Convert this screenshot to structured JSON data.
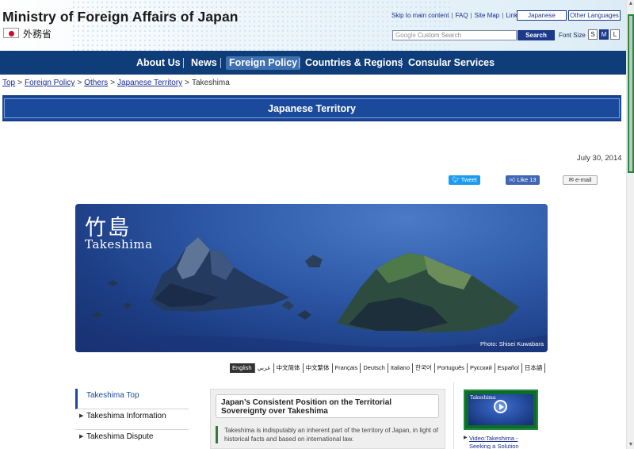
{
  "header": {
    "site_title": "Ministry of Foreign Affairs of Japan",
    "jp_label": "外務省",
    "links": [
      "Skip to main content",
      "FAQ",
      "Site Map",
      "Links"
    ],
    "lang_japanese": "Japanese",
    "lang_other": "Other Languages",
    "search_placeholder": "Custom Search",
    "search_google": "Google",
    "search_button": "Search",
    "font_size_label": "Font Size",
    "font_sizes": [
      "S",
      "M",
      "L"
    ],
    "font_size_selected": "M"
  },
  "nav": {
    "items": [
      "About Us",
      "News",
      "Foreign Policy",
      "Countries & Regions",
      "Consular Services"
    ],
    "active": "Foreign Policy"
  },
  "breadcrumb": {
    "items": [
      "Top",
      "Foreign Policy",
      "Others",
      "Japanese Territory"
    ],
    "current": "Takeshima"
  },
  "banner_title": "Japanese Territory",
  "date": "July 30, 2014",
  "share": {
    "tweet": "Tweet",
    "like": "Like 13",
    "email": "e-mail"
  },
  "hero": {
    "kanji": "竹島",
    "title": "Takeshima",
    "credit": "Photo: Shisei Kuwabara"
  },
  "languages": {
    "items": [
      "English",
      "عربي",
      "中文简体",
      "中文繁体",
      "Français",
      "Deutsch",
      "Italiano",
      "한국어",
      "Português",
      "Русский",
      "Español",
      "日本語"
    ],
    "selected": "English"
  },
  "left_nav": {
    "items": [
      "Takeshima Top",
      "Takeshima Information",
      "Takeshima Dispute"
    ]
  },
  "center": {
    "title": "Japan’s Consistent Position on the Territorial Sovereignty over Takeshima",
    "body": "Takeshima is indisputably an inherent part of the territory of Japan, in light of historical facts and based on international law."
  },
  "video": {
    "thumb_title": "Takeshima",
    "link": "Video:Takeshima - Seeking a Solution"
  },
  "colors": {
    "nav_bg": "#0e3d79",
    "banner_bg": "#1b4a9c",
    "link": "#1a2d8f",
    "active_nav": "#3f71b1"
  }
}
